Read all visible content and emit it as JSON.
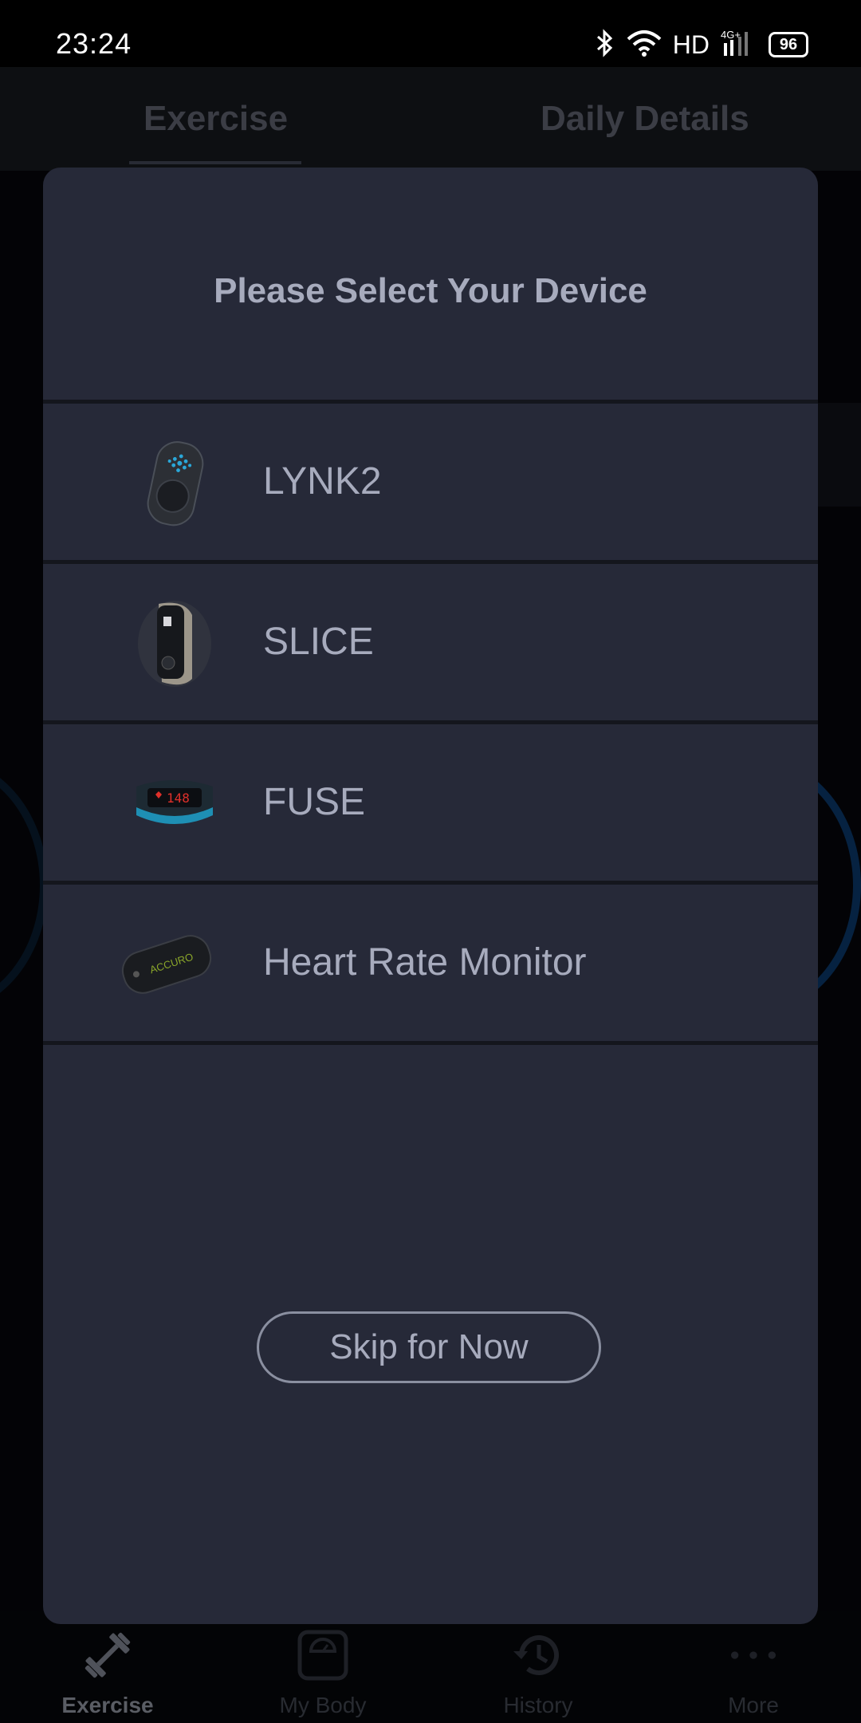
{
  "status_bar": {
    "time": "23:24",
    "hd_label": "HD",
    "network": "4G+",
    "battery": "96",
    "icons": [
      "bluetooth-icon",
      "wifi-icon",
      "signal-icon",
      "battery-icon"
    ]
  },
  "background": {
    "tabs": [
      {
        "label": "Exercise",
        "active": true
      },
      {
        "label": "Daily Details",
        "active": false
      }
    ]
  },
  "dialog": {
    "title": "Please Select Your Device",
    "devices": [
      {
        "label": "LYNK2",
        "icon": "lynk2-device-image"
      },
      {
        "label": "SLICE",
        "icon": "slice-device-image"
      },
      {
        "label": "FUSE",
        "icon": "fuse-device-image",
        "display_text": "148"
      },
      {
        "label": "Heart Rate Monitor",
        "icon": "heart-rate-monitor-image",
        "brand_text": "ACCURO"
      }
    ],
    "skip_label": "Skip for Now"
  },
  "bottom_nav": {
    "items": [
      {
        "label": "Exercise",
        "icon": "dumbbell-icon",
        "active": true
      },
      {
        "label": "My Body",
        "icon": "scale-icon",
        "active": false
      },
      {
        "label": "History",
        "icon": "history-icon",
        "active": false
      },
      {
        "label": "More",
        "icon": "more-dots-icon",
        "active": false
      }
    ]
  },
  "colors": {
    "dialog_bg": "#262938",
    "text": "#a7abbd",
    "accent_blue": "#0d4a8a"
  }
}
